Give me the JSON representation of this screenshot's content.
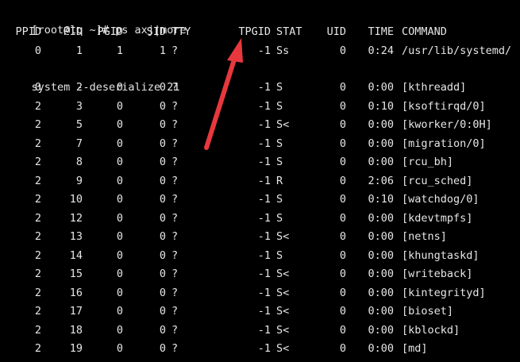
{
  "terminal": {
    "prompt": "[root@lq ~]# ps axj|more",
    "headers": {
      "ppid": "PPID",
      "pid": "PID",
      "pgid": "PGID",
      "sid": "SID",
      "tty": "TTY",
      "tpgid": "TPGID",
      "stat": "STAT",
      "uid": "UID",
      "time": "TIME",
      "command": "COMMAND"
    },
    "first_row": {
      "ppid": "0",
      "pid": "1",
      "pgid": "1",
      "sid": "1",
      "tty": "?",
      "tpgid": "-1",
      "stat": "Ss",
      "uid": "0",
      "time": "0:24",
      "command": "/usr/lib/systemd/"
    },
    "wrap_line": "system --deserialize 21",
    "rows": [
      {
        "ppid": "0",
        "pid": "2",
        "pgid": "0",
        "sid": "0",
        "tty": "?",
        "tpgid": "-1",
        "stat": "S",
        "uid": "0",
        "time": "0:00",
        "command": "[kthreadd]"
      },
      {
        "ppid": "2",
        "pid": "3",
        "pgid": "0",
        "sid": "0",
        "tty": "?",
        "tpgid": "-1",
        "stat": "S",
        "uid": "0",
        "time": "0:10",
        "command": "[ksoftirqd/0]"
      },
      {
        "ppid": "2",
        "pid": "5",
        "pgid": "0",
        "sid": "0",
        "tty": "?",
        "tpgid": "-1",
        "stat": "S<",
        "uid": "0",
        "time": "0:00",
        "command": "[kworker/0:0H]"
      },
      {
        "ppid": "2",
        "pid": "7",
        "pgid": "0",
        "sid": "0",
        "tty": "?",
        "tpgid": "-1",
        "stat": "S",
        "uid": "0",
        "time": "0:00",
        "command": "[migration/0]"
      },
      {
        "ppid": "2",
        "pid": "8",
        "pgid": "0",
        "sid": "0",
        "tty": "?",
        "tpgid": "-1",
        "stat": "S",
        "uid": "0",
        "time": "0:00",
        "command": "[rcu_bh]"
      },
      {
        "ppid": "2",
        "pid": "9",
        "pgid": "0",
        "sid": "0",
        "tty": "?",
        "tpgid": "-1",
        "stat": "R",
        "uid": "0",
        "time": "2:06",
        "command": "[rcu_sched]"
      },
      {
        "ppid": "2",
        "pid": "10",
        "pgid": "0",
        "sid": "0",
        "tty": "?",
        "tpgid": "-1",
        "stat": "S",
        "uid": "0",
        "time": "0:10",
        "command": "[watchdog/0]"
      },
      {
        "ppid": "2",
        "pid": "12",
        "pgid": "0",
        "sid": "0",
        "tty": "?",
        "tpgid": "-1",
        "stat": "S",
        "uid": "0",
        "time": "0:00",
        "command": "[kdevtmpfs]"
      },
      {
        "ppid": "2",
        "pid": "13",
        "pgid": "0",
        "sid": "0",
        "tty": "?",
        "tpgid": "-1",
        "stat": "S<",
        "uid": "0",
        "time": "0:00",
        "command": "[netns]"
      },
      {
        "ppid": "2",
        "pid": "14",
        "pgid": "0",
        "sid": "0",
        "tty": "?",
        "tpgid": "-1",
        "stat": "S",
        "uid": "0",
        "time": "0:00",
        "command": "[khungtaskd]"
      },
      {
        "ppid": "2",
        "pid": "15",
        "pgid": "0",
        "sid": "0",
        "tty": "?",
        "tpgid": "-1",
        "stat": "S<",
        "uid": "0",
        "time": "0:00",
        "command": "[writeback]"
      },
      {
        "ppid": "2",
        "pid": "16",
        "pgid": "0",
        "sid": "0",
        "tty": "?",
        "tpgid": "-1",
        "stat": "S<",
        "uid": "0",
        "time": "0:00",
        "command": "[kintegrityd]"
      },
      {
        "ppid": "2",
        "pid": "17",
        "pgid": "0",
        "sid": "0",
        "tty": "?",
        "tpgid": "-1",
        "stat": "S<",
        "uid": "0",
        "time": "0:00",
        "command": "[bioset]"
      },
      {
        "ppid": "2",
        "pid": "18",
        "pgid": "0",
        "sid": "0",
        "tty": "?",
        "tpgid": "-1",
        "stat": "S<",
        "uid": "0",
        "time": "0:00",
        "command": "[kblockd]"
      },
      {
        "ppid": "2",
        "pid": "19",
        "pgid": "0",
        "sid": "0",
        "tty": "?",
        "tpgid": "-1",
        "stat": "S<",
        "uid": "0",
        "time": "0:00",
        "command": "[md]"
      }
    ]
  },
  "annotation": {
    "arrow_color": "#e8383d",
    "icon": "arrow-pointing-to-tpgid-header"
  },
  "colors": {
    "background": "#000000",
    "foreground": "#e6e6e6"
  }
}
